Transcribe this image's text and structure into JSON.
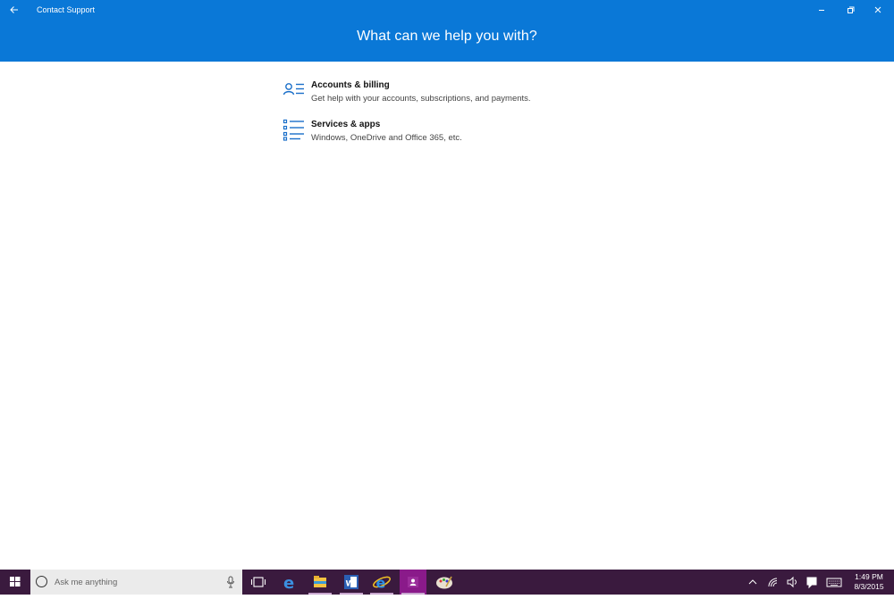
{
  "app": {
    "title": "Contact Support",
    "heading": "What can we help you with?"
  },
  "options": [
    {
      "title": "Accounts & billing",
      "description": "Get help with your accounts, subscriptions, and payments.",
      "icon": "person-list-icon"
    },
    {
      "title": "Services & apps",
      "description": "Windows, OneDrive and Office 365, etc.",
      "icon": "bullet-list-icon"
    }
  ],
  "taskbar": {
    "search_placeholder": "Ask me anything",
    "time": "1:49 PM",
    "date": "8/3/2015",
    "apps": [
      "edge-icon",
      "file-explorer-icon",
      "word-icon",
      "internet-explorer-icon",
      "contact-support-icon",
      "paint-icon"
    ]
  },
  "colors": {
    "header": "#0a78d7",
    "taskbar": "#3a1a3e",
    "active_app": "#8a1a8a",
    "icon_accent": "#1a6fc9"
  }
}
